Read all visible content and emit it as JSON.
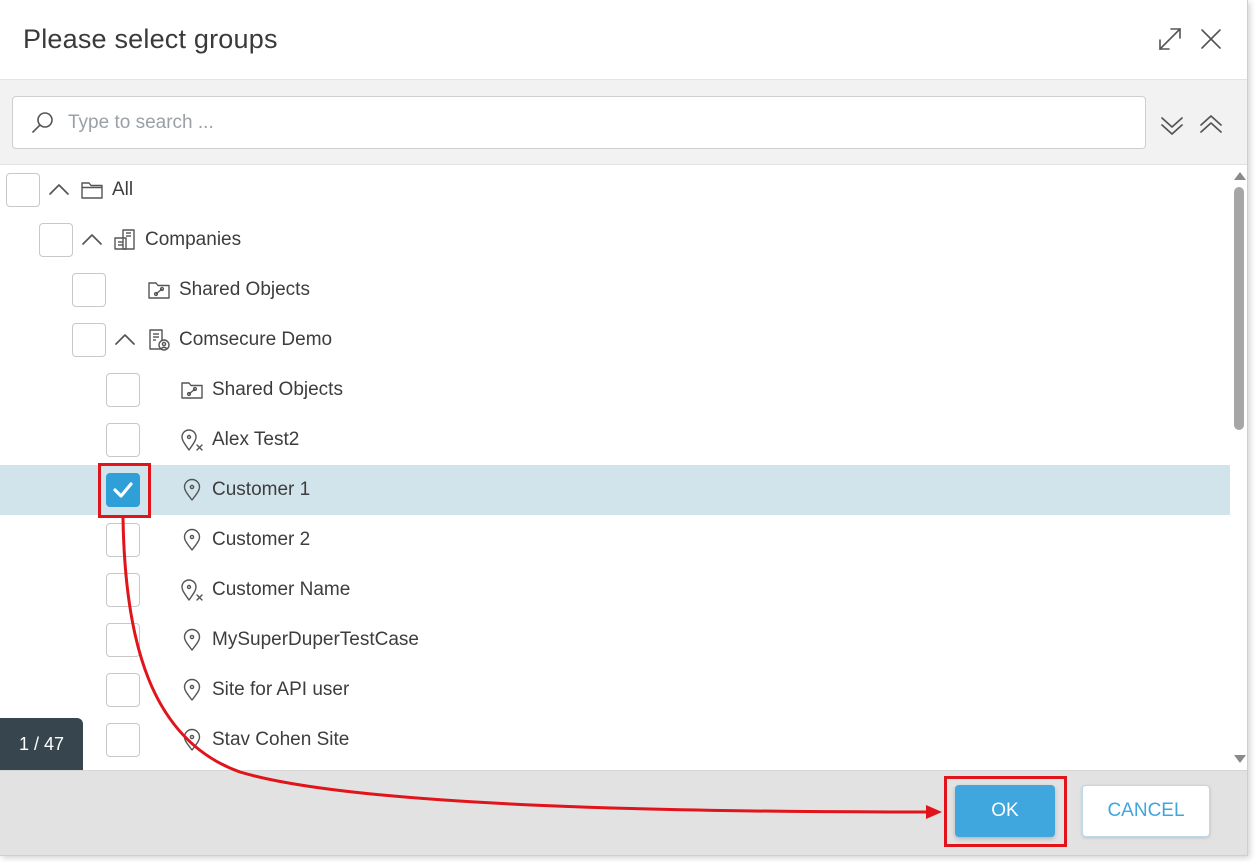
{
  "dialog": {
    "title": "Please select groups",
    "maximize_icon": "expand-arrows-icon",
    "close_icon": "close-x-icon"
  },
  "search": {
    "placeholder": "Type to search ...",
    "value": "",
    "icon": "search-icon",
    "expand_all_icon": "double-chevron-down-icon",
    "collapse_all_icon": "double-chevron-up-icon"
  },
  "tree": {
    "rows": [
      {
        "label": "All",
        "icon": "folder-icon",
        "expanded": true,
        "checked": false
      },
      {
        "label": "Companies",
        "icon": "companies-icon",
        "expanded": true,
        "checked": false
      },
      {
        "label": "Shared Objects",
        "icon": "shared-objects-icon",
        "checked": false
      },
      {
        "label": "Comsecure Demo",
        "icon": "company-icon",
        "expanded": true,
        "checked": false
      },
      {
        "label": "Shared Objects",
        "icon": "shared-objects-icon",
        "checked": false
      },
      {
        "label": "Alex Test2",
        "icon": "site-disabled-icon",
        "checked": false
      },
      {
        "label": "Customer 1",
        "icon": "site-pin-icon",
        "checked": true,
        "selected": true
      },
      {
        "label": "Customer 2",
        "icon": "site-pin-icon",
        "checked": false
      },
      {
        "label": "Customer Name",
        "icon": "site-disabled-icon",
        "checked": false
      },
      {
        "label": "MySuperDuperTestCase",
        "icon": "site-pin-icon",
        "checked": false
      },
      {
        "label": "Site for API user",
        "icon": "site-pin-icon",
        "checked": false
      },
      {
        "label": "Stav Cohen Site",
        "icon": "site-pin-icon",
        "checked": false
      }
    ]
  },
  "counter": {
    "text": "1 / 47"
  },
  "footer": {
    "ok_label": "OK",
    "cancel_label": "CANCEL"
  },
  "colors": {
    "accent": "#3fa6de",
    "checkbox_checked": "#2f9fd8",
    "selected_row": "#d1e4ec",
    "annotation": "#e0141a",
    "counter_bg": "#37454f"
  }
}
